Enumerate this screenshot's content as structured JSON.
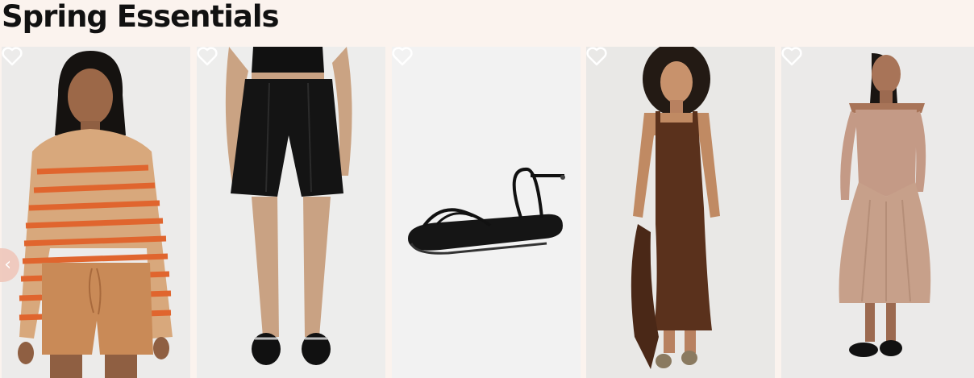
{
  "section": {
    "title": "Spring Essentials"
  },
  "carousel": {
    "prev_icon": "chevron-left-icon",
    "products": [
      {
        "name": "Striped Sweater & Knit Shorts",
        "icon": "heart-icon"
      },
      {
        "name": "Black Pleated Shorts",
        "icon": "heart-icon"
      },
      {
        "name": "Black Strappy Sandals",
        "icon": "heart-icon"
      },
      {
        "name": "Brown Square Neck Maxi Dress",
        "icon": "heart-icon"
      },
      {
        "name": "Blush Off-Shoulder Drop Waist Dress",
        "icon": "heart-icon"
      }
    ]
  },
  "colors": {
    "background": "#fbf3ee",
    "title": "#111111",
    "arrow": "#f0c9bd"
  }
}
